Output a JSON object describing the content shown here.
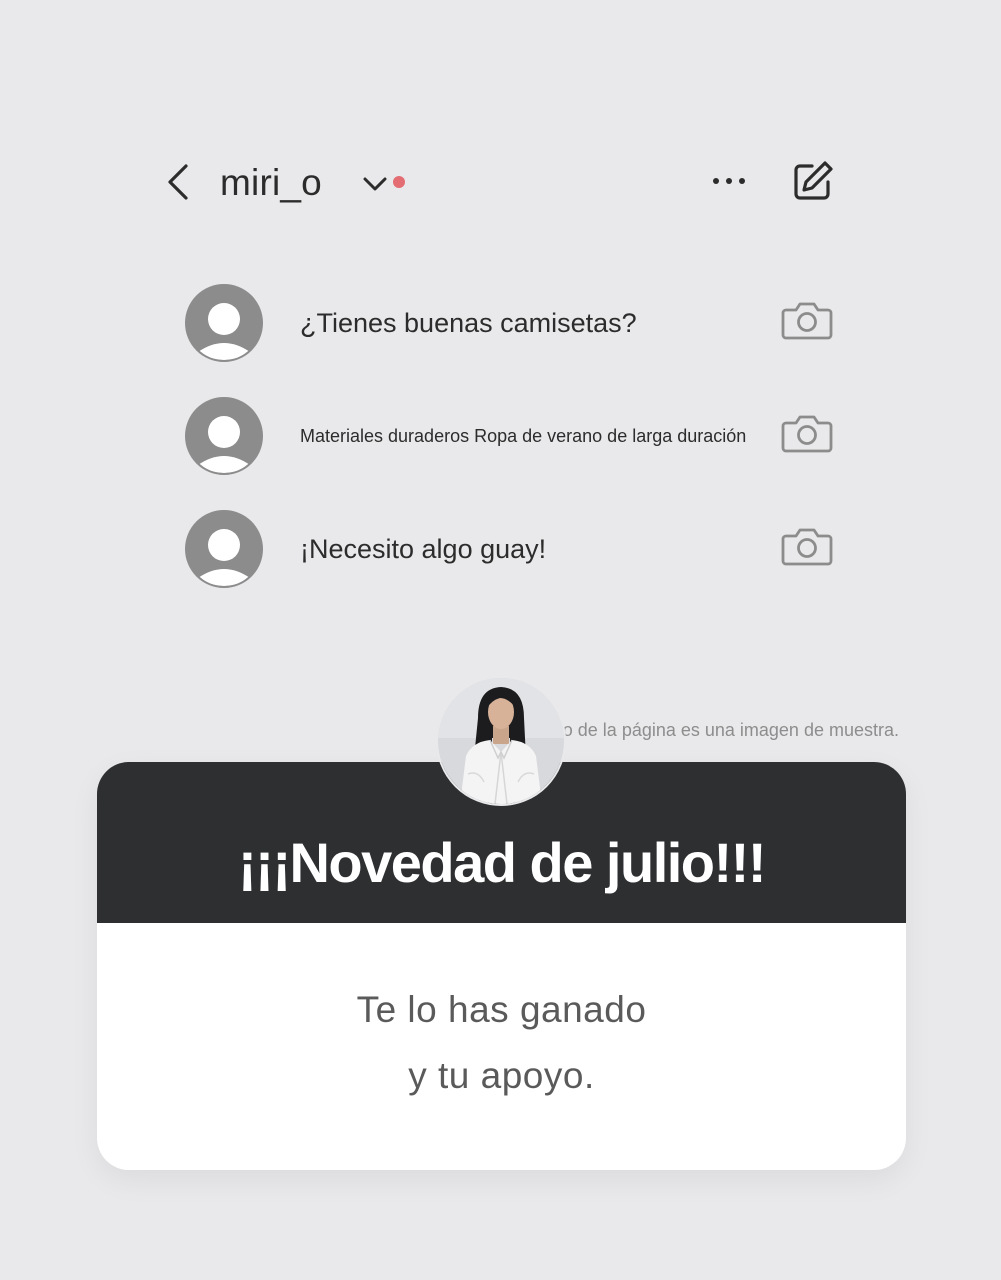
{
  "header": {
    "username": "miri_o",
    "icons": {
      "back": "chevron-left-icon",
      "dropdown": "chevron-down-icon",
      "more": "more-horizontal-icon",
      "edit": "edit-icon"
    },
    "notification_color": "#e36d72"
  },
  "messages": [
    {
      "text": "¿Tienes buenas camisetas?",
      "avatar_icon": "user-avatar-icon",
      "action_icon": "camera-icon"
    },
    {
      "text": "Materiales duraderos Ropa de verano de larga duración",
      "avatar_icon": "user-avatar-icon",
      "action_icon": "camera-icon"
    },
    {
      "text": "¡Necesito algo guay!",
      "avatar_icon": "user-avatar-icon",
      "action_icon": "camera-icon"
    }
  ],
  "disclaimer": "El retrato de la página es una imagen de muestra.",
  "card": {
    "title": "¡¡¡Novedad de julio!!!",
    "line1": "Te lo has ganado",
    "line2": "y tu apoyo."
  },
  "colors": {
    "background": "#e9e9eb",
    "card_header": "#2d2f31",
    "avatar_gray": "#8c8c8c",
    "text_dark": "#2c2c2c"
  }
}
